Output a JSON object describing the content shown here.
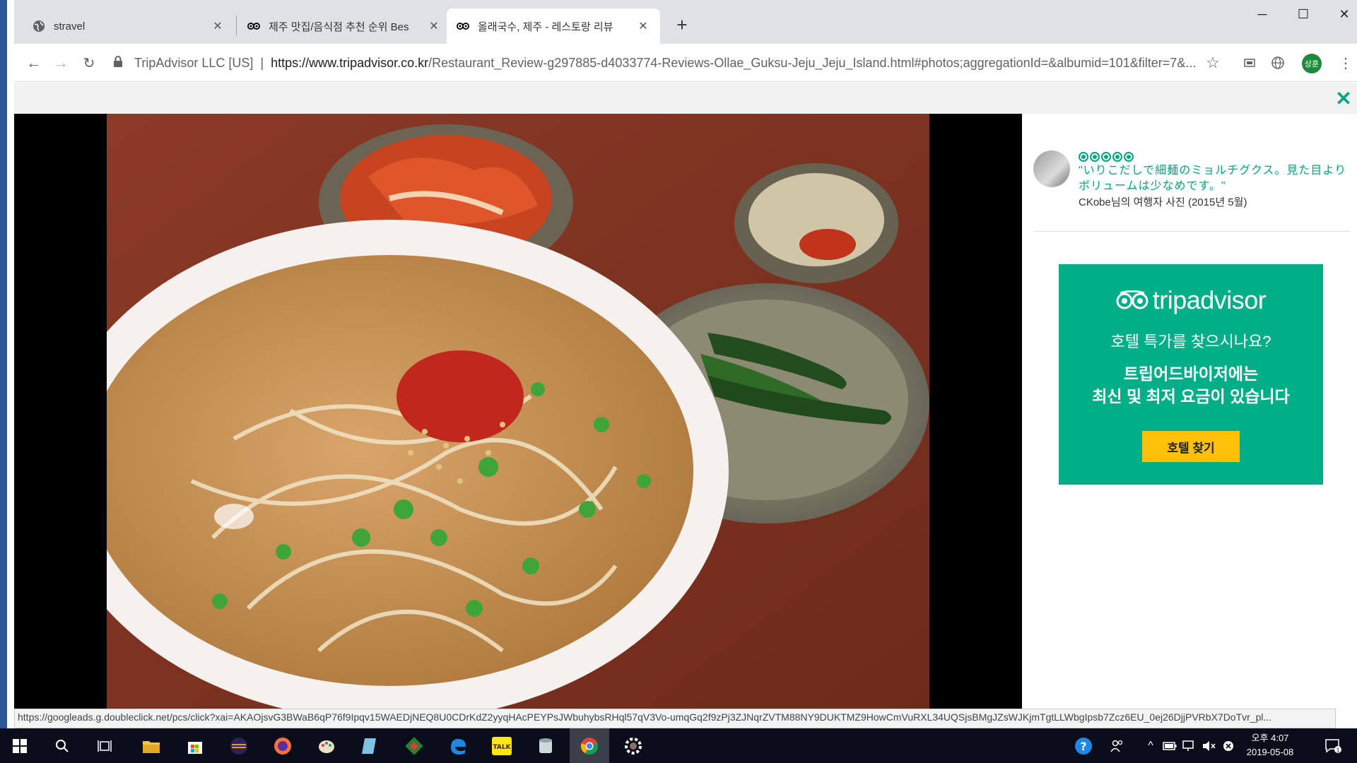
{
  "browser": {
    "tabs": [
      {
        "title": "stravel",
        "icon": "globe-icon"
      },
      {
        "title": "제주 맛집/음식점 추천 순위 Bes",
        "icon": "tripadvisor-icon"
      },
      {
        "title": "올래국수, 제주 - 레스토랑 리뷰",
        "icon": "tripadvisor-icon",
        "active": true
      }
    ],
    "window_controls": {
      "minimize": "─",
      "maximize": "☐",
      "close": "✕"
    },
    "new_tab": "+",
    "address": {
      "org": "TripAdvisor LLC [US]",
      "separator": "|",
      "host": "https://www.tripadvisor.co.kr",
      "path": "/Restaurant_Review-g297885-d4033774-Reviews-Ollae_Guksu-Jeju_Jeju_Island.html#photos;aggregationId=&albumid=101&filter=7&..."
    },
    "profile_initials": "상훈"
  },
  "overlay": {
    "close": "✕"
  },
  "review": {
    "rating_bubbles": 5,
    "quote": "\"いりこだしで細麺のミョルチグクス。見た目よりボリュームは少なめです。\"",
    "credit": "CKobe님의 여행자 사진 (2015년 5월)"
  },
  "ad": {
    "brand": "tripadvisor",
    "line1": "호텔 특가를 찾으시나요?",
    "line2": "트립어드바이저에는",
    "line3": "최신 및 최저 요금이 있습니다",
    "button": "호텔 찾기",
    "colors": {
      "background": "#00af87",
      "button": "#ffc107"
    }
  },
  "status_url": "https://googleads.g.doubleclick.net/pcs/click?xai=AKAOjsvG3BWaB6qP76f9Ipqv15WAEDjNEQ8U0CDrKdZ2yyqHAcPEYPsJWbuhybsRHql57qV3Vo-umqGq2f9zPj3ZJNqrZVTM88NY9DUKTMZ9HowCmVuRXL34UQSjsBMgJZsWJKjmTgtLLWbgIpsb7Zcz6EU_0ej26DjjPVRbX7DoTvr_pl...",
  "taskbar": {
    "clock_time": "오후 4:07",
    "clock_date": "2019-05-08",
    "notification_count": "1"
  }
}
